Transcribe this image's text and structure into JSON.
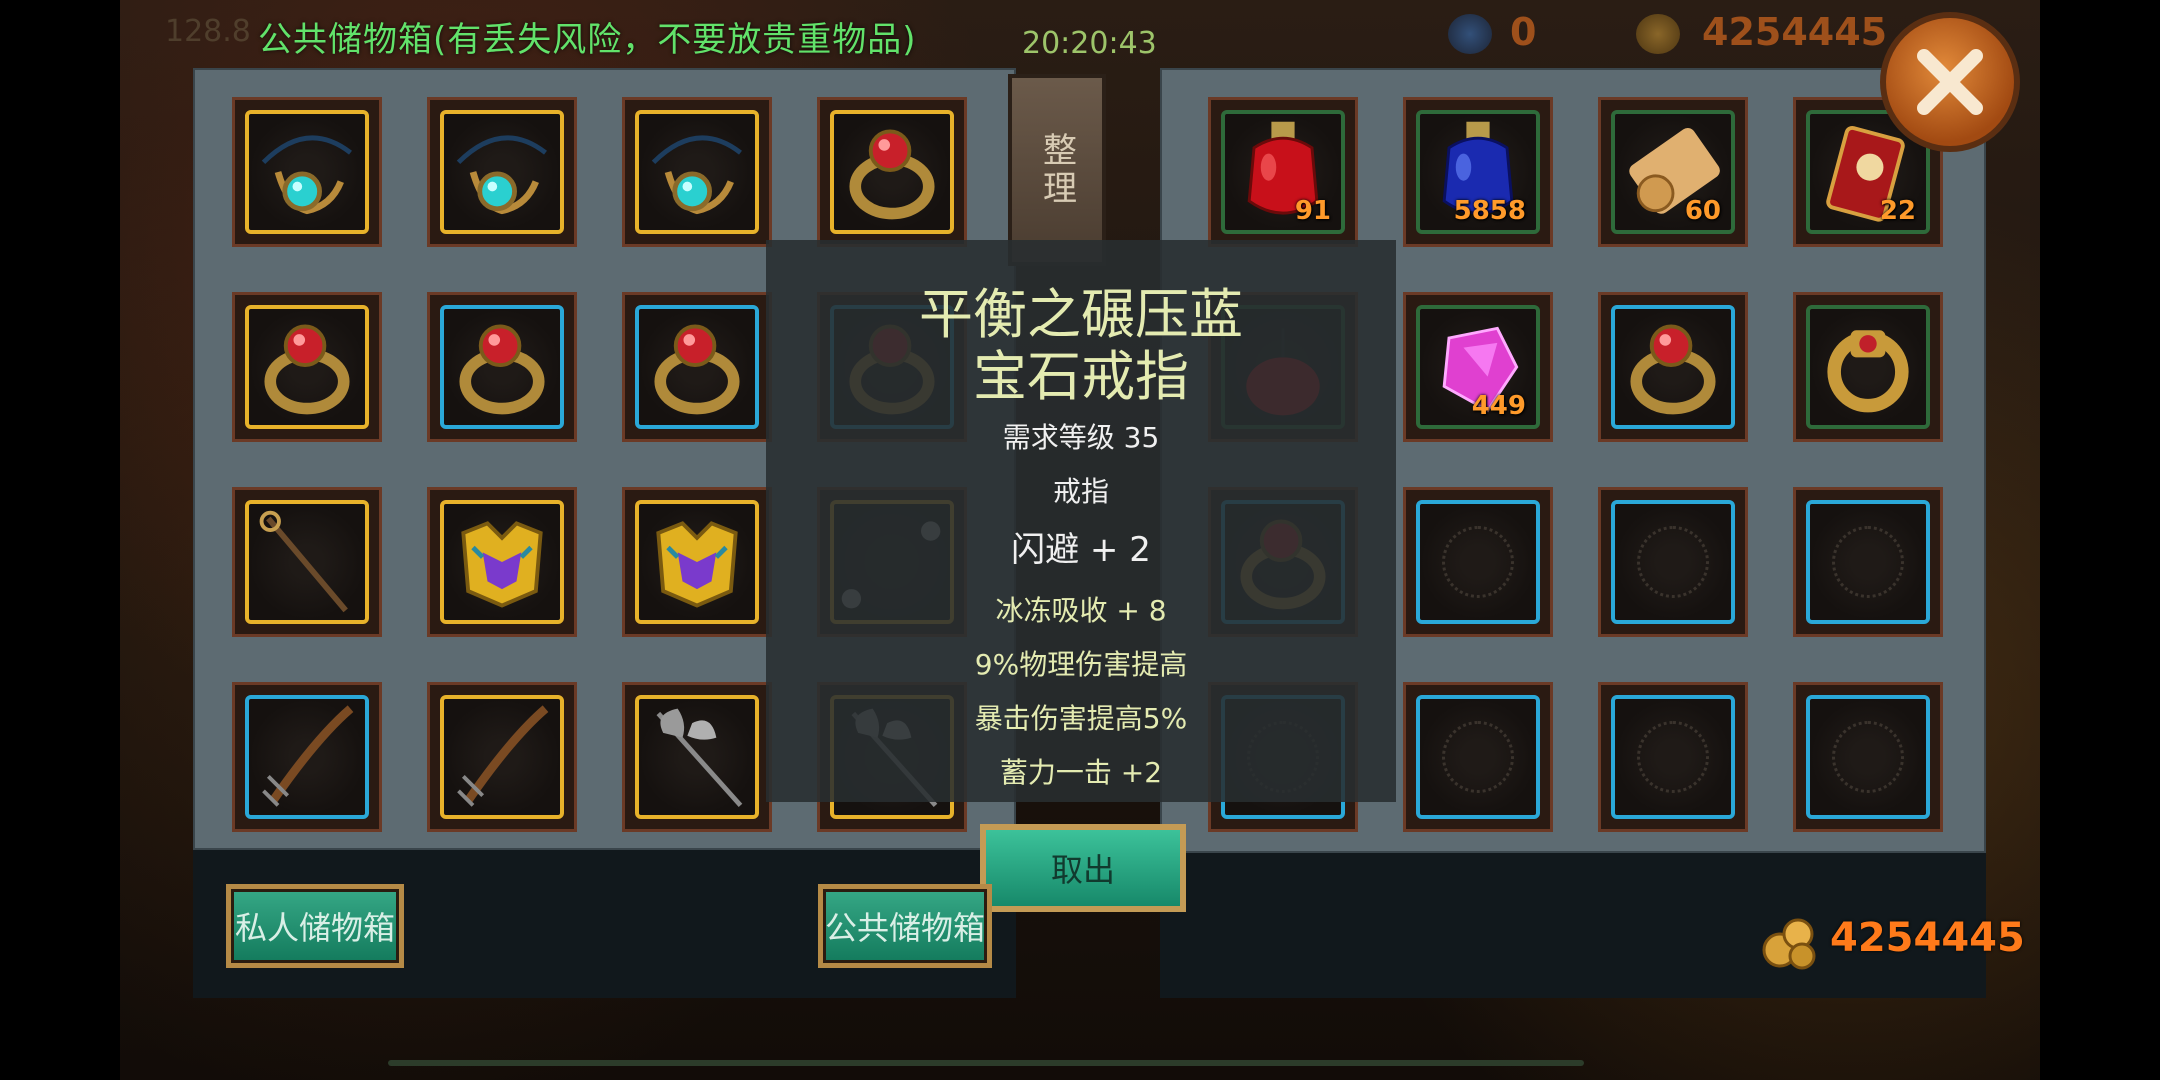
{
  "header": {
    "bg_number": "128.8",
    "title": "公共储物箱(有丢失风险，不要放贵重物品)",
    "clock": "20:20:43",
    "gem_count": "0",
    "gold_top": "4254445"
  },
  "buttons": {
    "sort": "整理",
    "take_out": "取出",
    "private_storage": "私人储物箱",
    "public_storage": "公共储物箱"
  },
  "tooltip": {
    "title_line1": "平衡之碾压蓝",
    "title_line2": "宝石戒指",
    "level": "需求等级 35",
    "type": "戒指",
    "main_stat": "闪避 + 2",
    "stats": [
      "冰冻吸收 + 8",
      "9%物理伤害提高",
      "暴击伤害提高5%",
      "蓄力一击 +2"
    ]
  },
  "inventory_right": {
    "counts": {
      "red_potion": "91",
      "blue_potion": "5858",
      "scroll": "60",
      "token": "22",
      "crystal": "449"
    },
    "gold": "4254445"
  },
  "icons": {
    "left_grid": [
      [
        "amulet-icon",
        "amulet-icon",
        "amulet-icon",
        "ring-icon"
      ],
      [
        "ring-icon",
        "ring-icon",
        "ring-icon",
        "ring-icon"
      ],
      [
        "staff-icon",
        "armor-icon",
        "armor-icon",
        "orb-icon"
      ],
      [
        "crossbow-icon",
        "crossbow-icon",
        "axe-icon",
        "axe-icon"
      ]
    ],
    "right_grid": [
      [
        "red-potion-icon",
        "blue-potion-icon",
        "scroll-icon",
        "token-icon"
      ],
      [
        "lantern-icon",
        "crystal-icon",
        "ring-icon",
        "signet-ring-icon"
      ],
      [
        "ring-icon",
        "empty",
        "empty",
        "empty"
      ],
      [
        "empty",
        "empty",
        "empty",
        "empty"
      ]
    ]
  },
  "colors": {
    "title_green": "#62e26a",
    "gold_orange": "#ff7a1a",
    "slot_blue": "#2aa8d8",
    "slot_gold": "#e8b22a"
  }
}
